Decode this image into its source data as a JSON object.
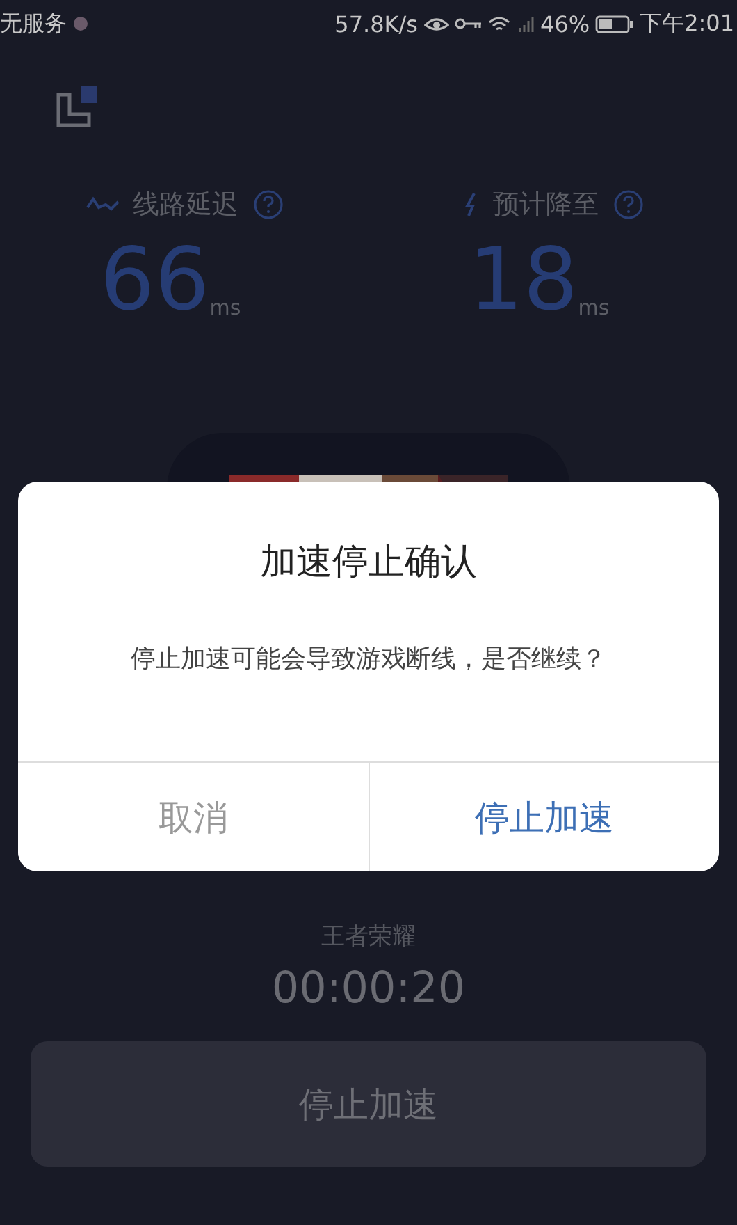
{
  "status_bar": {
    "carrier": "无服务",
    "speed": "57.8K/s",
    "battery": "46%",
    "time": "下午2:01"
  },
  "metrics": [
    {
      "label": "线路延迟",
      "value": "66",
      "unit": "ms",
      "kind": "latency"
    },
    {
      "label": "预计降至",
      "value": "18",
      "unit": "ms",
      "kind": "boost"
    }
  ],
  "game": {
    "kind": "picture",
    "name": "王者荣耀",
    "timer": "00:00:20"
  },
  "stop_button": "停止加速",
  "dialog": {
    "title": "加速停止确认",
    "message": "停止加速可能会导致游戏断线，是否继续？",
    "buttons": [
      {
        "label": "取消",
        "kind": "cancel"
      },
      {
        "label": "停止加速",
        "kind": "confirm"
      }
    ]
  }
}
